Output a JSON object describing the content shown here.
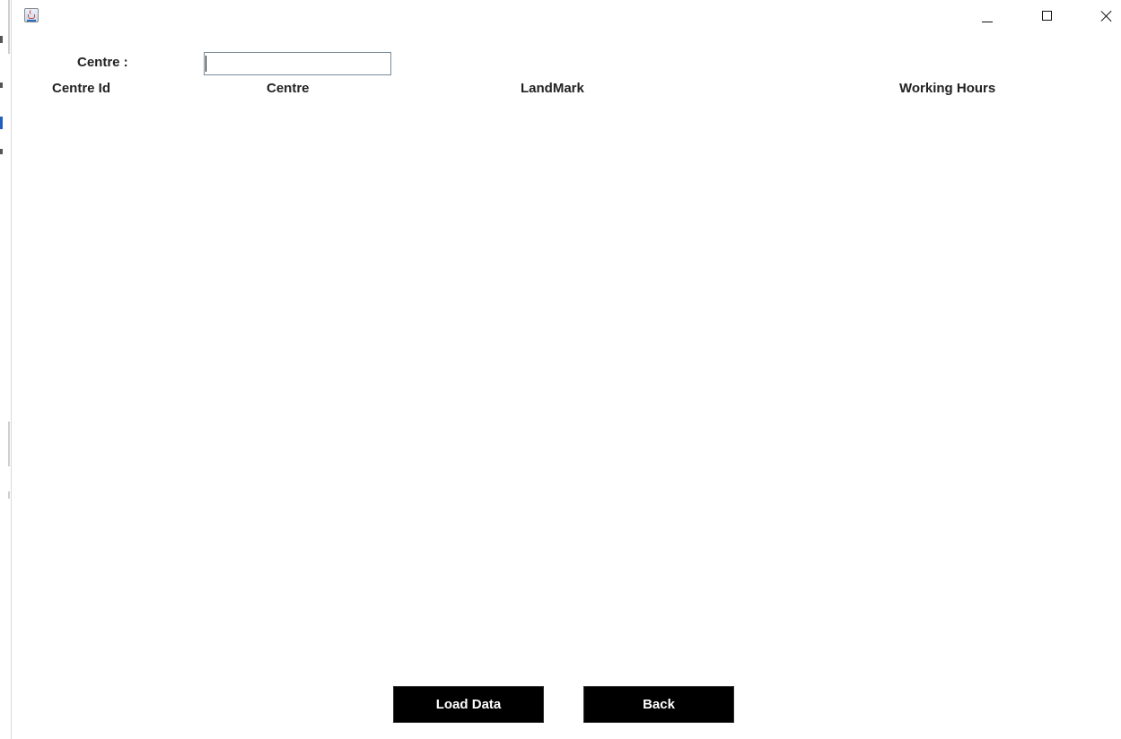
{
  "window": {
    "icon": "java-cup-icon",
    "controls": {
      "minimize_icon": "minimize-icon",
      "maximize_icon": "maximize-icon",
      "close_icon": "close-icon"
    }
  },
  "form": {
    "centre_label": "Centre :",
    "centre_value": ""
  },
  "table": {
    "columns": [
      "Centre Id",
      "Centre",
      "LandMark",
      "Working Hours"
    ],
    "rows": []
  },
  "buttons": {
    "load_data": "Load Data",
    "back": "Back"
  },
  "colors": {
    "button_bg": "#000000",
    "button_text": "#ffffff",
    "background": "#ffffff"
  }
}
